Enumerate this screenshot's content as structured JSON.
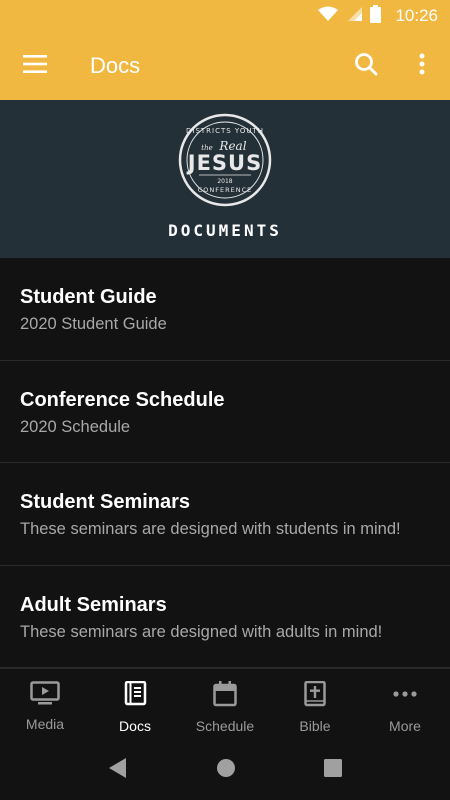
{
  "status_bar": {
    "time": "10:26"
  },
  "app_bar": {
    "title": "Docs"
  },
  "banner": {
    "logo_text_top": "DISTRICTS YOUTH",
    "logo_text_the": "the",
    "logo_text_real": "Real",
    "logo_text_main": "JESUS",
    "logo_text_year": "2018",
    "logo_text_bottom": "CONFERENCE",
    "title": "DOCUMENTS"
  },
  "documents": [
    {
      "title": "Student Guide",
      "subtitle": "2020 Student Guide"
    },
    {
      "title": "Conference Schedule",
      "subtitle": "2020 Schedule"
    },
    {
      "title": "Student Seminars",
      "subtitle": "These seminars are designed with students in mind!"
    },
    {
      "title": "Adult Seminars",
      "subtitle": "These seminars are designed with adults in mind!"
    }
  ],
  "bottom_nav": [
    {
      "label": "Media",
      "icon": "tv-play-icon"
    },
    {
      "label": "Docs",
      "icon": "book-icon",
      "active": true
    },
    {
      "label": "Schedule",
      "icon": "calendar-icon"
    },
    {
      "label": "Bible",
      "icon": "bible-icon"
    },
    {
      "label": "More",
      "icon": "more-horizontal-icon"
    }
  ],
  "colors": {
    "accent": "#f0b840",
    "banner_bg": "#243038",
    "background": "#121212"
  }
}
